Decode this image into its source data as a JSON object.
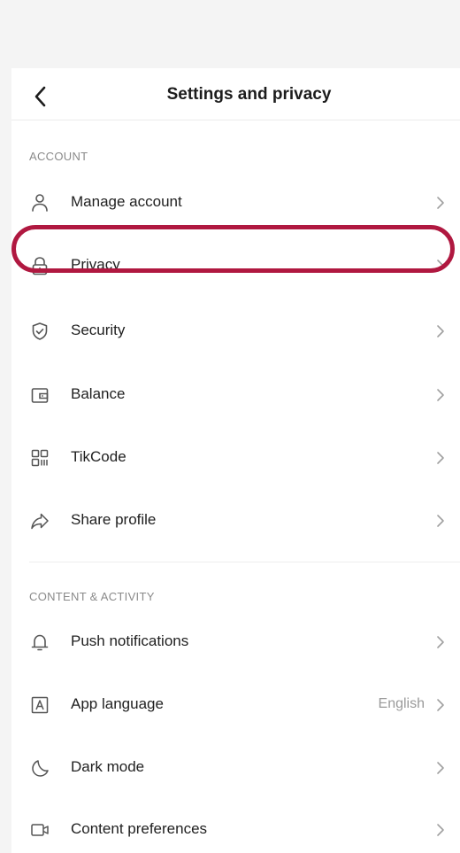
{
  "header": {
    "title": "Settings and privacy",
    "back_icon": "chevron-left-icon"
  },
  "sections": [
    {
      "label": "ACCOUNT",
      "items": [
        {
          "label": "Manage account",
          "icon": "person-icon"
        },
        {
          "label": "Privacy",
          "icon": "lock-icon",
          "highlighted": true
        },
        {
          "label": "Security",
          "icon": "shield-icon"
        },
        {
          "label": "Balance",
          "icon": "wallet-icon"
        },
        {
          "label": "TikCode",
          "icon": "qr-code-icon"
        },
        {
          "label": "Share profile",
          "icon": "share-icon"
        }
      ]
    },
    {
      "label": "CONTENT & ACTIVITY",
      "items": [
        {
          "label": "Push notifications",
          "icon": "bell-icon"
        },
        {
          "label": "App language",
          "icon": "language-icon",
          "value": "English"
        },
        {
          "label": "Dark mode",
          "icon": "moon-icon"
        },
        {
          "label": "Content preferences",
          "icon": "video-icon"
        }
      ]
    }
  ],
  "colors": {
    "highlight": "#b01840",
    "text_primary": "#1f1f1f",
    "text_secondary": "#8a8a8a",
    "chevron": "#a0a0a0"
  }
}
